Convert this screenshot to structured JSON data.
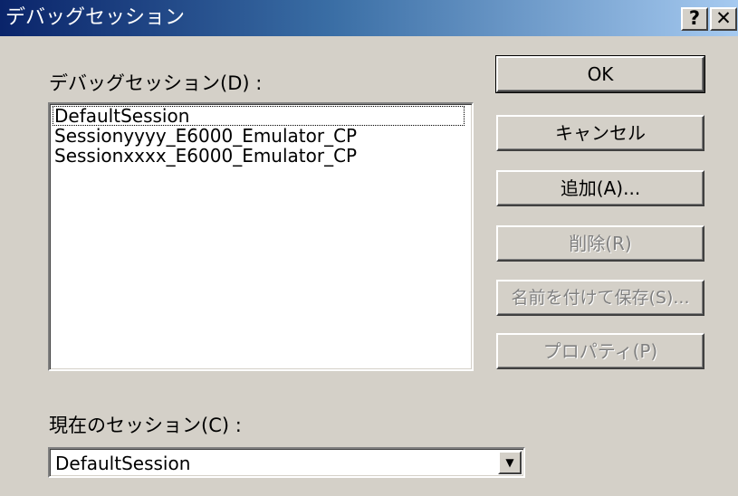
{
  "window": {
    "title": "デバッグセッション",
    "help_glyph": "?",
    "close_glyph": "✕"
  },
  "sessions_label": "デバッグセッション(D) :",
  "sessions": [
    "DefaultSession",
    "Sessionyyyy_E6000_Emulator_CP",
    "Sessionxxxx_E6000_Emulator_CP"
  ],
  "current_label": "現在のセッション(C) :",
  "current_value": "DefaultSession",
  "dropdown_glyph": "▼",
  "buttons": {
    "ok": "OK",
    "cancel": "キャンセル",
    "add": "追加(A)...",
    "delete": "削除(R)",
    "save_as": "名前を付けて保存(S)...",
    "properties": "プロパティ(P)"
  }
}
